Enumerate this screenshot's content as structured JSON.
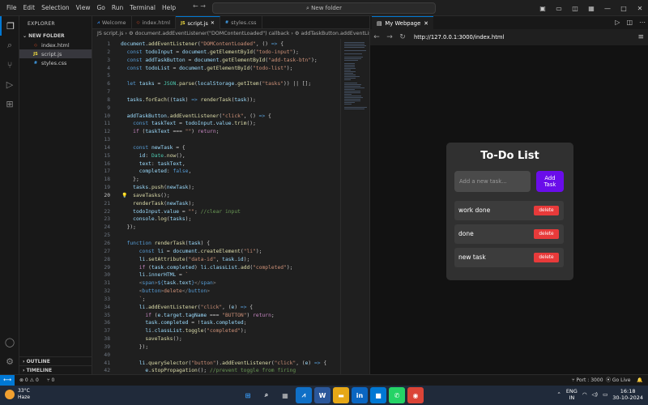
{
  "titlebar": {
    "menus": [
      "File",
      "Edit",
      "Selection",
      "View",
      "Go",
      "Run",
      "Terminal",
      "Help"
    ],
    "search": "New folder",
    "nav": "← →"
  },
  "sidebar": {
    "header": "EXPLORER",
    "folder": "NEW FOLDER",
    "files": [
      {
        "name": "index.html",
        "icon": "◇",
        "color": "#e44d26"
      },
      {
        "name": "script.js",
        "icon": "JS",
        "color": "#f1dd3f"
      },
      {
        "name": "styles.css",
        "icon": "#",
        "color": "#42a5f5"
      }
    ],
    "outline": "OUTLINE",
    "timeline": "TIMELINE"
  },
  "tabs": [
    {
      "label": "Welcome",
      "icon": "⩘",
      "color": "#3794ff"
    },
    {
      "label": "index.html",
      "icon": "◇",
      "color": "#e44d26"
    },
    {
      "label": "script.js",
      "icon": "JS",
      "color": "#f1dd3f"
    },
    {
      "label": "styles.css",
      "icon": "#",
      "color": "#42a5f5"
    }
  ],
  "breadcrumb": "JS script.js › ⚙ document.addEventListener(\"DOMContentLoaded\") callback › ⚙ addTaskButton.addEventListen",
  "editor": {
    "current_line": 20,
    "lightbulb_line": 20,
    "lines": [
      {
        "n": 1,
        "html": "<span class=\"v\">document</span>.<span class=\"f\">addEventListener</span>(<span class=\"s\">\"DOMContentLoaded\"</span>, () <span class=\"kb\">=&gt;</span> {"
      },
      {
        "n": 2,
        "html": "  <span class=\"kb\">const</span> <span class=\"v\">todoInput</span> = <span class=\"v\">document</span>.<span class=\"f\">getElementById</span>(<span class=\"s\">\"todo-input\"</span>);"
      },
      {
        "n": 3,
        "html": "  <span class=\"kb\">const</span> <span class=\"v\">addTaskButton</span> = <span class=\"v\">document</span>.<span class=\"f\">getElementById</span>(<span class=\"s\">\"add-task-btn\"</span>);"
      },
      {
        "n": 4,
        "html": "  <span class=\"kb\">const</span> <span class=\"v\">todoList</span> = <span class=\"v\">document</span>.<span class=\"f\">getElementById</span>(<span class=\"s\">\"todo-list\"</span>);"
      },
      {
        "n": 5,
        "html": ""
      },
      {
        "n": 6,
        "html": "  <span class=\"kb\">let</span> <span class=\"v\">tasks</span> = <span class=\"t\">JSON</span>.<span class=\"f\">parse</span>(<span class=\"v\">localStorage</span>.<span class=\"f\">getItem</span>(<span class=\"s\">\"tasks\"</span>)) || [];"
      },
      {
        "n": 7,
        "html": ""
      },
      {
        "n": 8,
        "html": "  <span class=\"v\">tasks</span>.<span class=\"f\">forEach</span>((<span class=\"v\">task</span>) <span class=\"kb\">=&gt;</span> <span class=\"f\">renderTask</span>(<span class=\"v\">task</span>));"
      },
      {
        "n": 9,
        "html": ""
      },
      {
        "n": 10,
        "html": "  <span class=\"v\">addTaskButton</span>.<span class=\"f\">addEventListener</span>(<span class=\"s\">\"click\"</span>, () <span class=\"kb\">=&gt;</span> {"
      },
      {
        "n": 11,
        "html": "    <span class=\"kb\">const</span> <span class=\"v\">taskText</span> = <span class=\"v\">todoInput</span>.<span class=\"v\">value</span>.<span class=\"f\">trim</span>();"
      },
      {
        "n": 12,
        "html": "    <span class=\"k\">if</span> (<span class=\"v\">taskText</span> === <span class=\"s\">\"\"</span>) <span class=\"k\">return</span>;"
      },
      {
        "n": 13,
        "html": ""
      },
      {
        "n": 14,
        "html": "    <span class=\"kb\">const</span> <span class=\"v\">newTask</span> = {"
      },
      {
        "n": 15,
        "html": "      <span class=\"v\">id</span>: <span class=\"t\">Date</span>.<span class=\"f\">now</span>(),"
      },
      {
        "n": 16,
        "html": "      <span class=\"v\">text</span>: <span class=\"v\">taskText</span>,"
      },
      {
        "n": 17,
        "html": "      <span class=\"v\">completed</span>: <span class=\"kb\">false</span>,"
      },
      {
        "n": 18,
        "html": "    };"
      },
      {
        "n": 19,
        "html": "    <span class=\"v\">tasks</span>.<span class=\"f\">push</span>(<span class=\"v\">newTask</span>);"
      },
      {
        "n": 20,
        "html": "    <span class=\"f\">saveTasks</span>();"
      },
      {
        "n": 21,
        "html": "    <span class=\"f\">renderTask</span>(<span class=\"v\">newTask</span>);"
      },
      {
        "n": 22,
        "html": "    <span class=\"v\">todoInput</span>.<span class=\"v\">value</span> = <span class=\"s\">\"\"</span>; <span class=\"c\">//clear input</span>"
      },
      {
        "n": 23,
        "html": "    <span class=\"v\">console</span>.<span class=\"f\">log</span>(<span class=\"v\">tasks</span>);"
      },
      {
        "n": 24,
        "html": "  });"
      },
      {
        "n": 25,
        "html": ""
      },
      {
        "n": 26,
        "html": "  <span class=\"kb\">function</span> <span class=\"f\">renderTask</span>(<span class=\"v\">task</span>) {"
      },
      {
        "n": 27,
        "html": "      <span class=\"kb\">const</span> <span class=\"v\">li</span> = <span class=\"v\">document</span>.<span class=\"f\">createElement</span>(<span class=\"s\">\"li\"</span>);"
      },
      {
        "n": 28,
        "html": "      <span class=\"v\">li</span>.<span class=\"f\">setAttribute</span>(<span class=\"s\">\"data-id\"</span>, <span class=\"v\">task</span>.<span class=\"v\">id</span>);"
      },
      {
        "n": 29,
        "html": "      <span class=\"k\">if</span> (<span class=\"v\">task</span>.<span class=\"v\">completed</span>) <span class=\"v\">li</span>.<span class=\"v\">classList</span>.<span class=\"f\">add</span>(<span class=\"s\">\"completed\"</span>);"
      },
      {
        "n": 30,
        "html": "      <span class=\"v\">li</span>.<span class=\"v\">innerHTML</span> = <span class=\"s\">`</span>"
      },
      {
        "n": 31,
        "html": "      <span class=\"g\">&lt;</span><span class=\"tag\">span</span><span class=\"g\">&gt;</span><span class=\"kb\">${</span><span class=\"v\">task</span>.<span class=\"v\">text</span><span class=\"kb\">}</span><span class=\"g\">&lt;/</span><span class=\"tag\">span</span><span class=\"g\">&gt;</span>"
      },
      {
        "n": 32,
        "html": "      <span class=\"g\">&lt;</span><span class=\"tag\">button</span><span class=\"g\">&gt;</span><span class=\"s\">delete</span><span class=\"g\">&lt;/</span><span class=\"tag\">button</span><span class=\"g\">&gt;</span>"
      },
      {
        "n": 33,
        "html": "      <span class=\"s\">`</span>;"
      },
      {
        "n": 34,
        "html": "      <span class=\"v\">li</span>.<span class=\"f\">addEventListener</span>(<span class=\"s\">\"click\"</span>, (<span class=\"v\">e</span>) <span class=\"kb\">=&gt;</span> {"
      },
      {
        "n": 35,
        "html": "        <span class=\"k\">if</span> (<span class=\"v\">e</span>.<span class=\"v\">target</span>.<span class=\"v\">tagName</span> === <span class=\"s\">\"BUTTON\"</span>) <span class=\"k\">return</span>;"
      },
      {
        "n": 36,
        "html": "        <span class=\"v\">task</span>.<span class=\"v\">completed</span> = !<span class=\"v\">task</span>.<span class=\"v\">completed</span>;"
      },
      {
        "n": 37,
        "html": "        <span class=\"v\">li</span>.<span class=\"v\">classList</span>.<span class=\"f\">toggle</span>(<span class=\"s\">\"completed\"</span>);"
      },
      {
        "n": 38,
        "html": "        <span class=\"f\">saveTasks</span>();"
      },
      {
        "n": 39,
        "html": "      });"
      },
      {
        "n": 40,
        "html": ""
      },
      {
        "n": 41,
        "html": "      <span class=\"v\">li</span>.<span class=\"f\">querySelector</span>(<span class=\"s\">\"button\"</span>).<span class=\"f\">addEventListener</span>(<span class=\"s\">\"click\"</span>, (<span class=\"v\">e</span>) <span class=\"kb\">=&gt;</span> {"
      },
      {
        "n": 42,
        "html": "        <span class=\"v\">e</span>.<span class=\"f\">stopPropagation</span>(); <span class=\"c\">//prevent toggle from firing</span>"
      }
    ]
  },
  "preview": {
    "tab_label": "My Webpage",
    "url": "http://127.0.0.1:3000/index.html",
    "app": {
      "title": "To-Do List",
      "input_placeholder": "Add a new task...",
      "add_button": "Add Task",
      "delete_label": "delete",
      "items": [
        "work done",
        "done",
        "new task"
      ]
    }
  },
  "statusbar": {
    "problems": "⊗ 0 ⚠ 0",
    "ports": "⑂ 0",
    "port": "⑂ Port : 3000",
    "golive": "⦿ Go Live",
    "bell": "🔔"
  },
  "taskbar": {
    "temp": "33°C",
    "weather": "Haze",
    "lang1": "ENG",
    "lang2": "IN",
    "time": "16:18",
    "date": "30-10-2024",
    "apps": [
      {
        "label": "⊞",
        "color": "transparent",
        "fg": "#3aa0ff"
      },
      {
        "label": "⌕",
        "color": "transparent",
        "fg": "#ffffff"
      },
      {
        "label": "▦",
        "color": "transparent",
        "fg": "#cccccc"
      },
      {
        "label": "⩘",
        "color": "#0f6fc6",
        "fg": "#ffffff"
      },
      {
        "label": "W",
        "color": "#2b579a",
        "fg": "#ffffff"
      },
      {
        "label": "▬",
        "color": "#e6a817",
        "fg": "#ffffff"
      },
      {
        "label": "in",
        "color": "#0a66c2",
        "fg": "#ffffff"
      },
      {
        "label": "■",
        "color": "#0078d4",
        "fg": "#ffffff"
      },
      {
        "label": "✆",
        "color": "#25d366",
        "fg": "#ffffff"
      },
      {
        "label": "◉",
        "color": "#db4437",
        "fg": "#ffffff"
      }
    ]
  }
}
